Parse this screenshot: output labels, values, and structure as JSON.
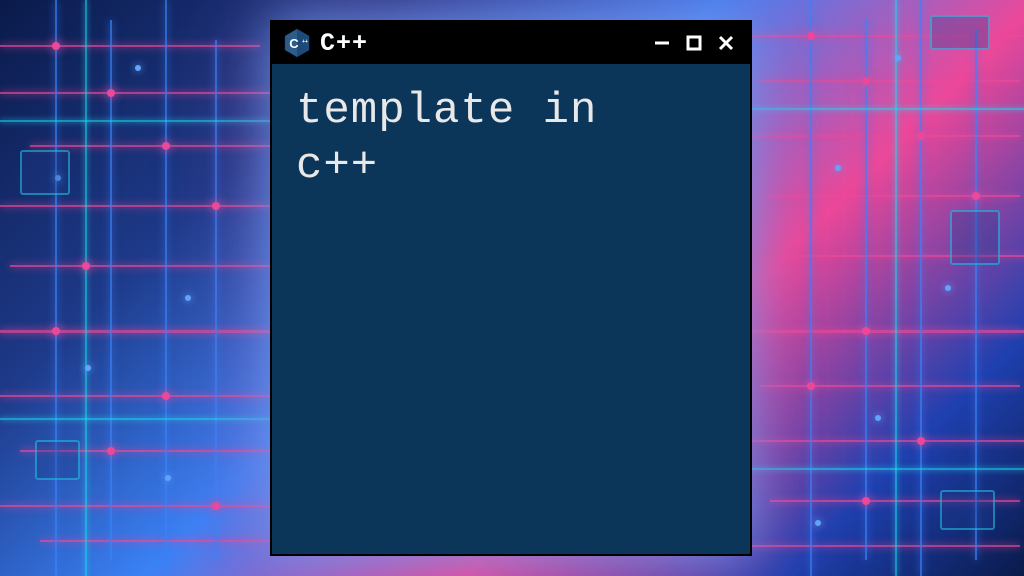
{
  "window": {
    "title": "C++",
    "icon_name": "cpp-icon"
  },
  "terminal": {
    "content_line1": "template in",
    "content_line2": "c++"
  },
  "colors": {
    "terminal_bg": "#0b3559",
    "titlebar_bg": "#000000",
    "text": "#e8e8e8",
    "accent_pink": "#ec4899",
    "accent_blue": "#3b82f6",
    "accent_cyan": "#22d3ee"
  }
}
